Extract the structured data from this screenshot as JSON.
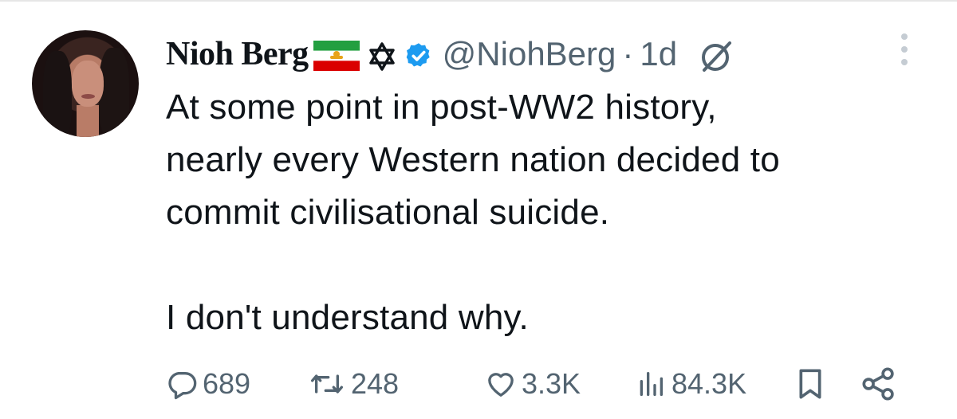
{
  "tweet": {
    "author_name": "Nioh Berg",
    "handle": "@NiohBerg",
    "separator": "·",
    "time": "1d",
    "text": "At some point in post-WW2 history,\nnearly every Western nation decided to\ncommit civilisational suicide.\n\nI don't understand why."
  },
  "badges": {
    "flag_icon": "iran-lion-sun-flag-icon",
    "star_icon": "star-of-david-icon",
    "verified_icon": "verified-badge-icon",
    "verified_color": "#1d9bf0"
  },
  "actions": {
    "replies": "689",
    "reposts": "248",
    "likes": "3.3K",
    "views": "84.3K"
  },
  "colors": {
    "secondary_text": "#536471",
    "primary_text": "#0f1419"
  }
}
